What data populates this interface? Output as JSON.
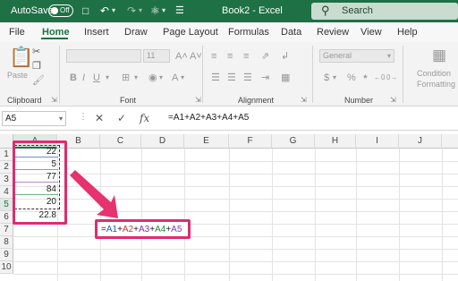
{
  "titlebar": {
    "autosave_label": "AutoSave",
    "autosave_state": "Off",
    "title": "Book2 - Excel",
    "search_placeholder": "Search"
  },
  "menu": [
    "File",
    "Home",
    "Insert",
    "Draw",
    "Page Layout",
    "Formulas",
    "Data",
    "Review",
    "View",
    "Help"
  ],
  "ribbon": {
    "paste": "Paste",
    "groups": [
      "Clipboard",
      "Font",
      "Alignment",
      "Number"
    ],
    "font_size": "11",
    "number_format": "General",
    "conditional": "Condition",
    "formatting": "Formatting"
  },
  "formula_bar": {
    "name_box": "A5",
    "formula": "=A1+A2+A3+A4+A5"
  },
  "grid": {
    "columns": [
      "A",
      "B",
      "C",
      "D",
      "E",
      "F",
      "G",
      "H",
      "I",
      "J"
    ],
    "rows": [
      "1",
      "2",
      "3",
      "4",
      "5",
      "6",
      "7",
      "8",
      "9",
      "10"
    ],
    "cells": [
      "22",
      "5",
      "77",
      "84",
      "20",
      "22.8"
    ],
    "formula_parts": [
      "=",
      "A1",
      "+",
      "A2",
      "+",
      "A3",
      "+",
      "A4",
      "+",
      "A5"
    ]
  },
  "colors": {
    "accent": "#1e7145",
    "highlight": "#dd2d6e"
  }
}
